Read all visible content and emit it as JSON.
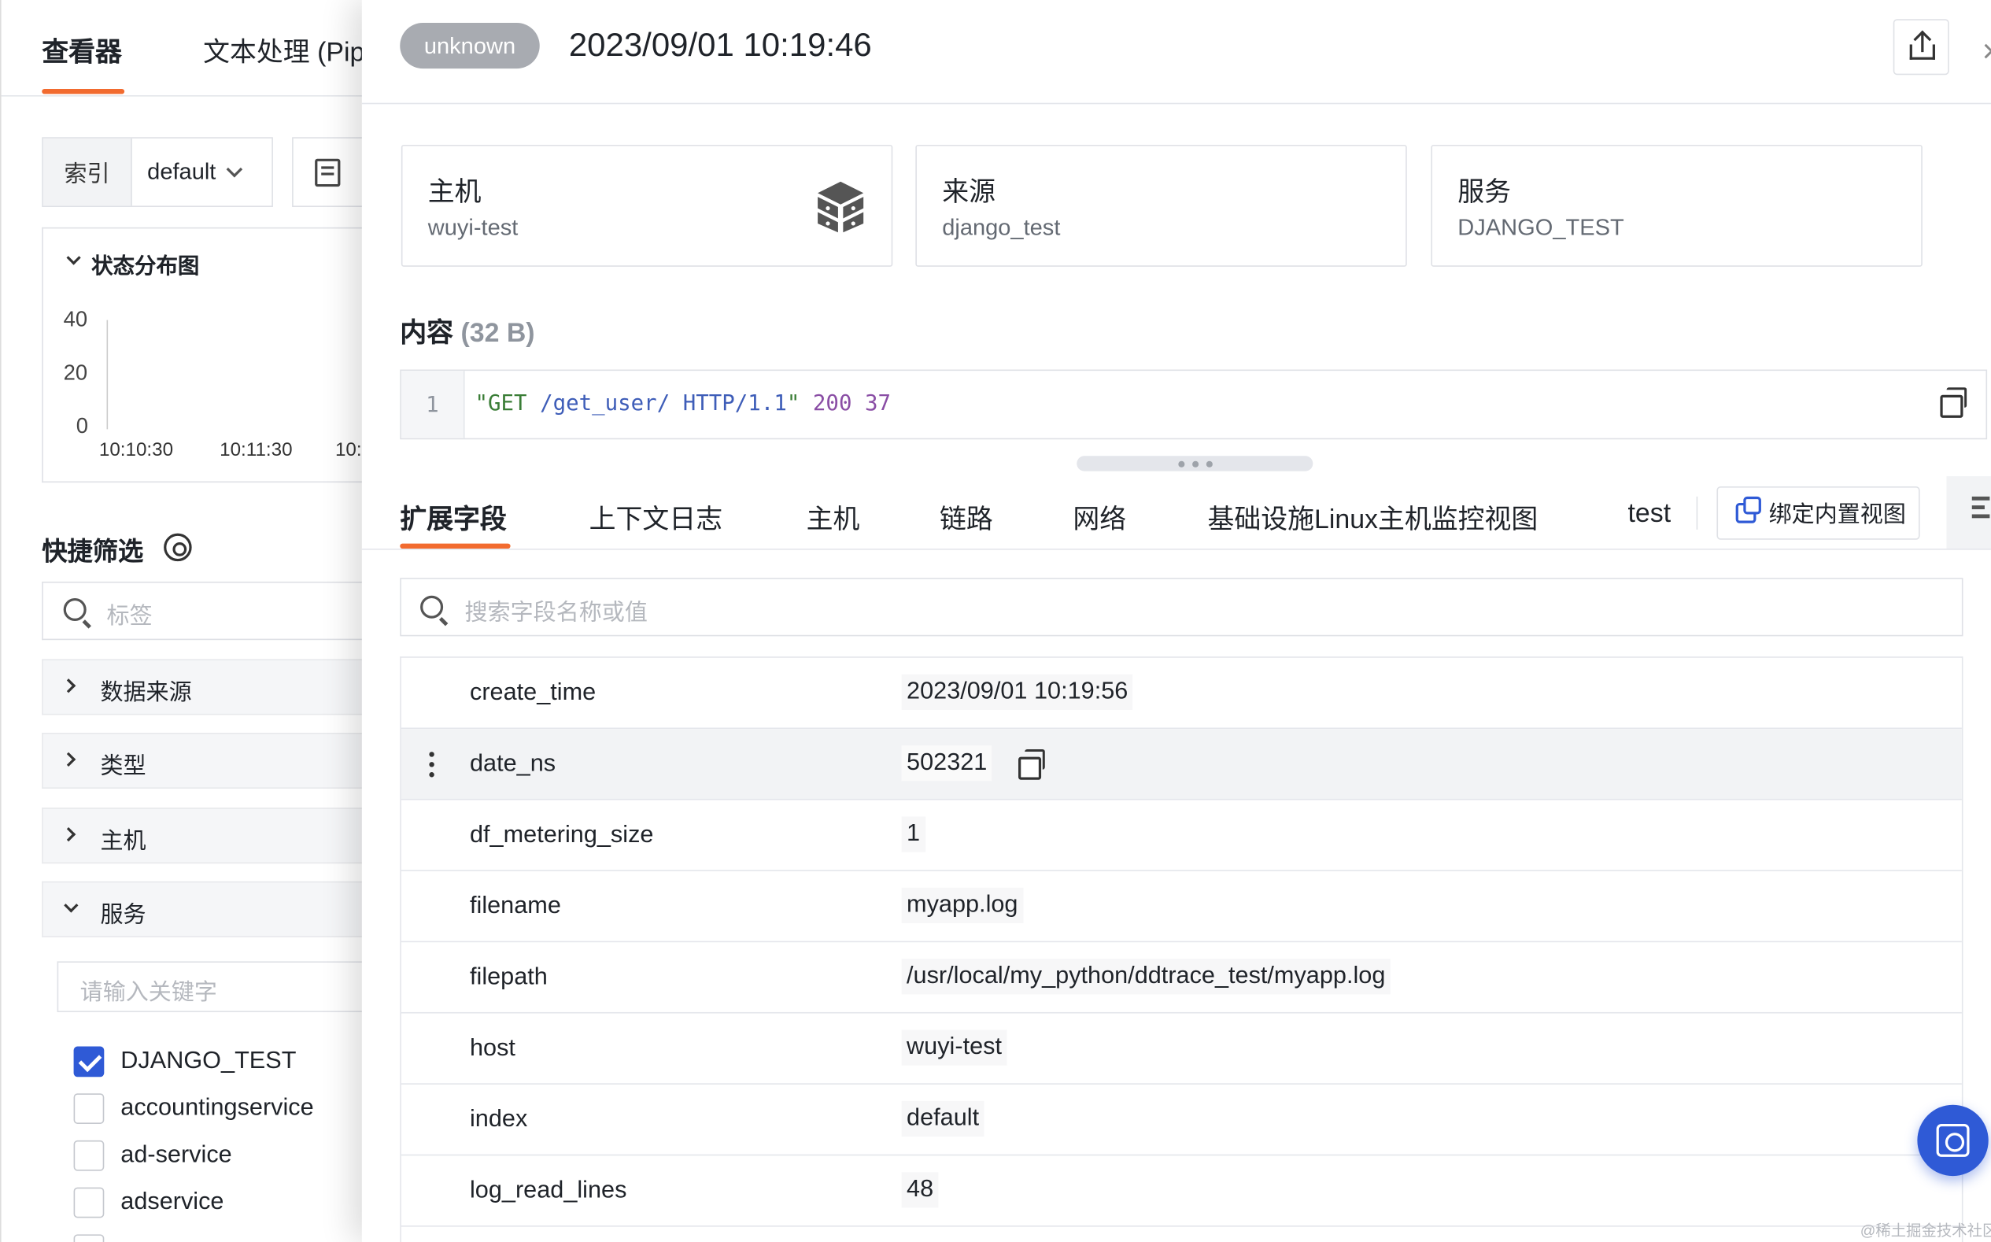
{
  "left": {
    "tabs": [
      "查看器",
      "文本处理 (Pip"
    ],
    "index_label": "索引",
    "index_value": "default",
    "dist": {
      "title": "状态分布图",
      "y_ticks": [
        "40",
        "20",
        "0"
      ],
      "x_ticks": [
        "10:10:30",
        "10:11:30",
        "10:"
      ]
    },
    "quick_filter": "快捷筛选",
    "tag_placeholder": "标签",
    "groups": [
      "数据来源",
      "类型",
      "主机",
      "服务"
    ],
    "keyword_placeholder": "请输入关键字",
    "services": [
      {
        "name": "DJANGO_TEST",
        "checked": true
      },
      {
        "name": "accountingservice",
        "checked": false
      },
      {
        "name": "ad-service",
        "checked": false
      },
      {
        "name": "adservice",
        "checked": false
      }
    ]
  },
  "drawer": {
    "status": "unknown",
    "time": "2023/09/01 10:19:46",
    "cards": [
      {
        "title": "主机",
        "value": "wuyi-test"
      },
      {
        "title": "来源",
        "value": "django_test"
      },
      {
        "title": "服务",
        "value": "DJANGO_TEST"
      }
    ],
    "content_title": "内容",
    "content_size": "(32 B)",
    "code": {
      "line": "1",
      "method": "\"GET",
      "path": "/get_user/ HTTP/1.1",
      "quote_end": "\"",
      "status": "200",
      "bytes": "37"
    },
    "tabs": [
      "扩展字段",
      "上下文日志",
      "主机",
      "链路",
      "网络",
      "基础设施Linux主机监控视图",
      "test"
    ],
    "bind_view": "绑定内置视图",
    "field_search_placeholder": "搜索字段名称或值",
    "fields": [
      {
        "key": "create_time",
        "value": "2023/09/01 10:19:56"
      },
      {
        "key": "date_ns",
        "value": "502321"
      },
      {
        "key": "df_metering_size",
        "value": "1"
      },
      {
        "key": "filename",
        "value": "myapp.log"
      },
      {
        "key": "filepath",
        "value": "/usr/local/my_python/ddtrace_test/myapp.log"
      },
      {
        "key": "host",
        "value": "wuyi-test"
      },
      {
        "key": "index",
        "value": "default"
      },
      {
        "key": "log_read_lines",
        "value": "48"
      }
    ],
    "watermark": "@稀土掘金技术社区"
  }
}
